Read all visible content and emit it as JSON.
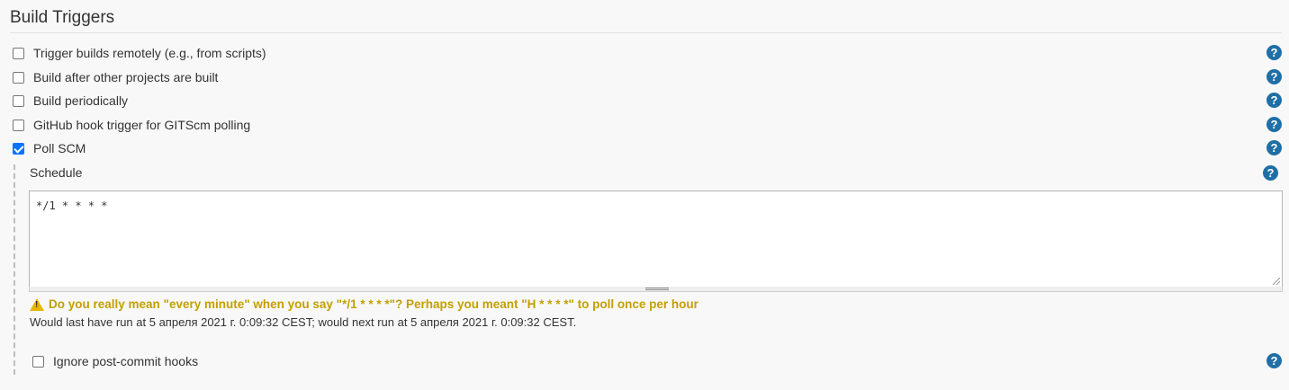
{
  "section": {
    "title": "Build Triggers"
  },
  "triggers": [
    {
      "label": "Trigger builds remotely (e.g., from scripts)",
      "checked": false
    },
    {
      "label": "Build after other projects are built",
      "checked": false
    },
    {
      "label": "Build periodically",
      "checked": false
    },
    {
      "label": "GitHub hook trigger for GITScm polling",
      "checked": false
    },
    {
      "label": "Poll SCM",
      "checked": true
    }
  ],
  "help_icon": {
    "glyph": "?",
    "name": "help-icon"
  },
  "poll_scm": {
    "schedule_label": "Schedule",
    "schedule_value": "*/1 * * * *",
    "warning": "Do you really mean \"every minute\" when you say \"*/1 * * * *\"? Perhaps you meant \"H * * * *\" to poll once per hour",
    "run_info": "Would last have run at 5 апреля 2021 г. 0:09:32 CEST; would next run at 5 апреля 2021 г. 0:09:32 CEST.",
    "ignore_hooks": {
      "label": "Ignore post-commit hooks",
      "checked": false
    }
  },
  "colors": {
    "help_blue": "#1f6fa6",
    "warning_text": "#c39f00",
    "checkbox_checked": "#0075ff"
  }
}
